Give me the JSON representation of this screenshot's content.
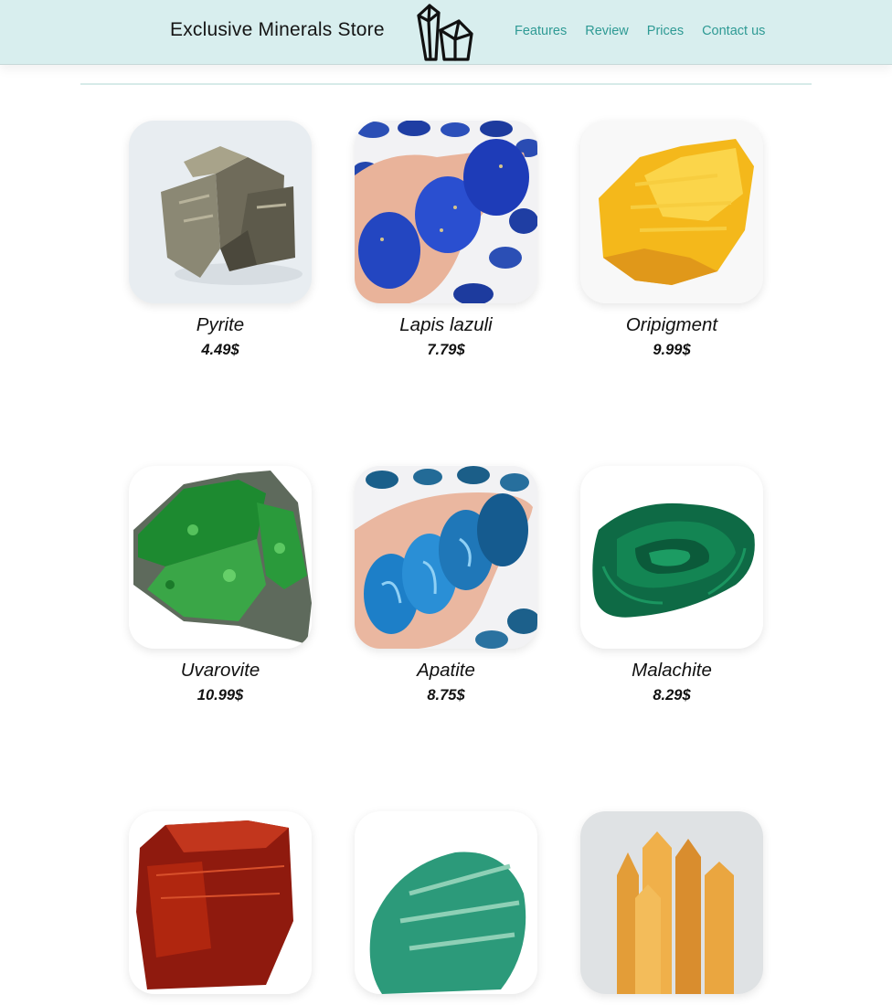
{
  "header": {
    "title": "Exclusive Minerals Store",
    "logo_icon": "crystals-logo-icon",
    "nav": [
      "Features",
      "Review",
      "Prices",
      "Contact us"
    ],
    "nav_color": "#2e9a94",
    "background": "#d8eeee"
  },
  "products": [
    {
      "name": "Pyrite",
      "price": "4.49$"
    },
    {
      "name": "Lapis lazuli",
      "price": "7.79$"
    },
    {
      "name": "Oripigment",
      "price": "9.99$"
    },
    {
      "name": "Uvarovite",
      "price": "10.99$"
    },
    {
      "name": "Apatite",
      "price": "8.75$"
    },
    {
      "name": "Malachite",
      "price": "8.29$"
    },
    {
      "name": "",
      "price": ""
    },
    {
      "name": "",
      "price": ""
    },
    {
      "name": "",
      "price": ""
    }
  ]
}
